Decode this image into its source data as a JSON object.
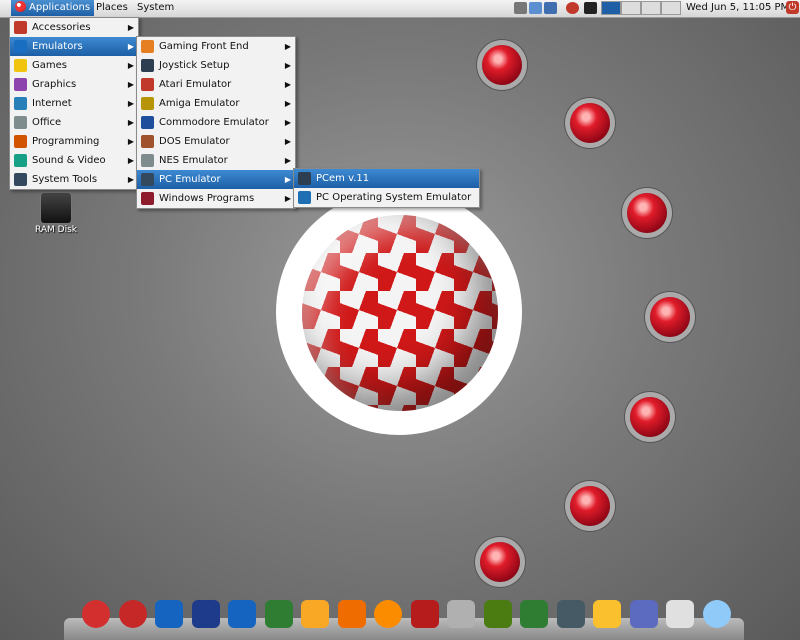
{
  "panel": {
    "menus": [
      "Applications",
      "Places",
      "System"
    ],
    "clock": "Wed Jun  5, 11:05 PM"
  },
  "menu_main": [
    {
      "label": "Accessories",
      "icon": "accessories-icon",
      "color": "#c0392b",
      "arrow": true
    },
    {
      "label": "Emulators",
      "icon": "emulators-icon",
      "color": "#1a6ec1",
      "arrow": true,
      "selected": true
    },
    {
      "label": "Games",
      "icon": "games-icon",
      "color": "#f1c40f",
      "arrow": true
    },
    {
      "label": "Graphics",
      "icon": "graphics-icon",
      "color": "#8e44ad",
      "arrow": true
    },
    {
      "label": "Internet",
      "icon": "internet-icon",
      "color": "#2980b9",
      "arrow": true
    },
    {
      "label": "Office",
      "icon": "office-icon",
      "color": "#7f8c8d",
      "arrow": true
    },
    {
      "label": "Programming",
      "icon": "programming-icon",
      "color": "#d35400",
      "arrow": true
    },
    {
      "label": "Sound & Video",
      "icon": "sound-video-icon",
      "color": "#16a085",
      "arrow": true
    },
    {
      "label": "System Tools",
      "icon": "system-tools-icon",
      "color": "#34495e",
      "arrow": true
    }
  ],
  "menu_emulators": [
    {
      "label": "Gaming Front End",
      "icon": "gaming-front-end-icon",
      "color": "#e67e22",
      "arrow": true
    },
    {
      "label": "Joystick Setup",
      "icon": "joystick-icon",
      "color": "#2c3e50",
      "arrow": true
    },
    {
      "label": "Atari Emulator",
      "icon": "atari-icon",
      "color": "#c0392b",
      "arrow": true
    },
    {
      "label": "Amiga Emulator",
      "icon": "amiga-icon",
      "color": "#b7950b",
      "arrow": true
    },
    {
      "label": "Commodore Emulator",
      "icon": "commodore-icon",
      "color": "#1f4e9c",
      "arrow": true
    },
    {
      "label": "DOS Emulator",
      "icon": "dos-icon",
      "color": "#a0522d",
      "arrow": true
    },
    {
      "label": "NES Emulator",
      "icon": "nes-icon",
      "color": "#7f8c8d",
      "arrow": true
    },
    {
      "label": "PC Emulator",
      "icon": "pc-icon",
      "color": "#34495e",
      "arrow": true,
      "selected": true
    },
    {
      "label": "Windows Programs",
      "icon": "wine-icon",
      "color": "#8e1c2c",
      "arrow": true
    }
  ],
  "menu_pc": [
    {
      "label": "PCem v.11",
      "icon": "pcem-icon",
      "color": "#2c3e50",
      "selected": true
    },
    {
      "label": "PC Operating System Emulator",
      "icon": "vmware-icon",
      "color": "#1f6fb5"
    }
  ],
  "desktop": {
    "ram_disk_label": "RAM Disk"
  },
  "dock": [
    {
      "name": "amiga-ball-dock-icon",
      "color": "#d32f2f",
      "round": true
    },
    {
      "name": "boing-dock-icon",
      "color": "#c62828",
      "round": true
    },
    {
      "name": "amiga-forever-dock-icon",
      "color": "#1565c0"
    },
    {
      "name": "commodore-dock-icon",
      "color": "#1e3a8a"
    },
    {
      "name": "fs-uae-dock-icon",
      "color": "#1565c0"
    },
    {
      "name": "s-dock-icon",
      "color": "#2e7d32"
    },
    {
      "name": "r-dock-icon",
      "color": "#f9a825"
    },
    {
      "name": "pinwheel-dock-icon",
      "color": "#ef6c00"
    },
    {
      "name": "disc-dock-icon",
      "color": "#fb8c00",
      "round": true
    },
    {
      "name": "joystick-dock-icon",
      "color": "#b71c1c"
    },
    {
      "name": "dbgl-dock-icon",
      "color": "#b0b0b0"
    },
    {
      "name": "gog-dock-icon",
      "color": "#4a7c12"
    },
    {
      "name": "cartridge-dock-icon",
      "color": "#2e7d32"
    },
    {
      "name": "tool-dock-icon",
      "color": "#455a64"
    },
    {
      "name": "amp-dock-icon",
      "color": "#fbc02d"
    },
    {
      "name": "computer-dock-icon",
      "color": "#5c6bc0"
    },
    {
      "name": "blank-dock-icon",
      "color": "#e0e0e0"
    },
    {
      "name": "trash-dock-icon",
      "color": "#90caf9",
      "round": true
    }
  ]
}
